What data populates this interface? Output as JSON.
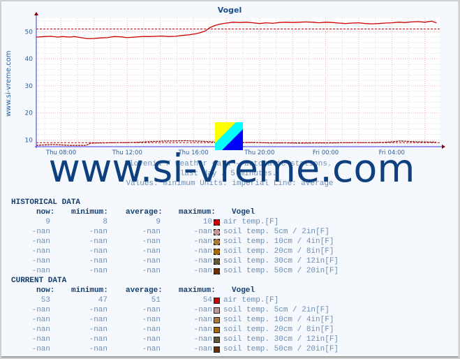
{
  "chart_data": {
    "type": "line",
    "title": "Vogel",
    "ylabel": "www.si-vreme.com",
    "xlabel": "",
    "ylim": [
      7.5,
      55
    ],
    "yticks": [
      10,
      20,
      30,
      40,
      50
    ],
    "xlim_hours": [
      6.5,
      30.9
    ],
    "xticks": [
      {
        "label": "Thu 08:00",
        "hour": 8
      },
      {
        "label": "Thu 12:00",
        "hour": 12
      },
      {
        "label": "Thu 16:00",
        "hour": 16
      },
      {
        "label": "Thu 20:00",
        "hour": 20
      },
      {
        "label": "Fri 00:00",
        "hour": 24
      },
      {
        "label": "Fri 04:00",
        "hour": 28
      }
    ],
    "grid": true,
    "series": [
      {
        "name": "air temp.[F] current",
        "color": "#cc0000",
        "style": "solid",
        "x_hours": [
          6.5,
          7.0,
          7.4,
          7.8,
          8.1,
          8.5,
          8.8,
          9.2,
          9.6,
          10.0,
          10.4,
          10.8,
          11.2,
          11.6,
          12.0,
          12.4,
          12.9,
          13.3,
          13.7,
          14.1,
          14.5,
          14.9,
          15.3,
          15.7,
          16.1,
          16.4,
          16.7,
          17.0,
          17.3,
          17.6,
          18.0,
          18.4,
          18.8,
          19.2,
          19.6,
          20.0,
          20.4,
          20.8,
          21.2,
          21.6,
          22.0,
          22.4,
          22.8,
          23.2,
          23.6,
          24.0,
          24.4,
          24.8,
          25.2,
          25.6,
          26.0,
          26.4,
          26.8,
          27.2,
          27.6,
          28.0,
          28.4,
          28.8,
          29.2,
          29.6,
          30.0,
          30.4,
          30.7
        ],
        "values": [
          48,
          48.2,
          48.3,
          48,
          48.2,
          48,
          48.2,
          47.8,
          47.4,
          47.5,
          47.7,
          47.8,
          48.2,
          48.1,
          47.8,
          48,
          48.2,
          48.2,
          48.3,
          48.4,
          48.2,
          48.3,
          48.6,
          48.8,
          49.2,
          49.6,
          50.2,
          51.5,
          52.3,
          52.8,
          53.2,
          53.5,
          53.4,
          53.5,
          53.3,
          53,
          53.3,
          53.1,
          53.4,
          53.5,
          53.4,
          53.5,
          53.6,
          53.5,
          53.3,
          53.5,
          53.4,
          53.2,
          53.0,
          53.2,
          53.3,
          53.0,
          52.9,
          53.0,
          53.2,
          53.3,
          53.5,
          53.4,
          53.6,
          53.7,
          53.5,
          53.9,
          53.3
        ]
      },
      {
        "name": "air temp.[F] current average",
        "color": "#cc0000",
        "style": "dashed",
        "constant": 51
      },
      {
        "name": "air temp.[F] historical",
        "color": "#880000",
        "style": "dashed",
        "x_hours": [
          6.5,
          7.5,
          8.5,
          9.5,
          9.8,
          10.5,
          11.5,
          12.5,
          13.5,
          14.5,
          15.5,
          16.5,
          17.5,
          18.5,
          19.5,
          20.5,
          21.5,
          22.5,
          23.5,
          24.5,
          25.5,
          26.5,
          27.5,
          28.0,
          28.5,
          29.5,
          30.5,
          30.7
        ],
        "values": [
          8.0,
          8.3,
          8.0,
          8.0,
          8.8,
          8.9,
          9.0,
          9.1,
          9.4,
          9.6,
          9.7,
          9.5,
          9.2,
          9.0,
          9.1,
          8.9,
          8.9,
          8.8,
          8.9,
          8.9,
          9.0,
          9.0,
          9.1,
          9.3,
          9.6,
          9.3,
          9.2,
          9.1
        ]
      },
      {
        "name": "air temp.[F] historical average",
        "color": "#cc0000",
        "style": "dashed",
        "constant": 9
      }
    ]
  },
  "chart": {
    "title": "Vogel",
    "side_label": "www.si-vreme.com",
    "subtitle_lines": [
      "Slovenia / weather data - automatic stations.",
      "last day / 5 minutes.",
      "Values: minimum  Units: imperial  Line: average"
    ],
    "watermark": "www.si-vreme.com",
    "logo_colors": [
      "#ffff00",
      "#00ffff",
      "#0000ff"
    ]
  },
  "historical": {
    "title": "HISTORICAL DATA",
    "headers": {
      "now": "now:",
      "minimum": "minimum:",
      "average": "average:",
      "maximum": "maximum:",
      "station": "Vogel"
    },
    "rows": [
      {
        "now": "9",
        "minimum": "8",
        "average": "9",
        "maximum": "10",
        "label": "air temp.[F]",
        "color": "#cc0000"
      },
      {
        "now": "-nan",
        "minimum": "-nan",
        "average": "-nan",
        "maximum": "-nan",
        "label": "soil temp. 5cm / 2in[F]",
        "color": "#c09898"
      },
      {
        "now": "-nan",
        "minimum": "-nan",
        "average": "-nan",
        "maximum": "-nan",
        "label": "soil temp. 10cm / 4in[F]",
        "color": "#b07838"
      },
      {
        "now": "-nan",
        "minimum": "-nan",
        "average": "-nan",
        "maximum": "-nan",
        "label": "soil temp. 20cm / 8in[F]",
        "color": "#a86800"
      },
      {
        "now": "-nan",
        "minimum": "-nan",
        "average": "-nan",
        "maximum": "-nan",
        "label": "soil temp. 30cm / 12in[F]",
        "color": "#605838"
      },
      {
        "now": "-nan",
        "minimum": "-nan",
        "average": "-nan",
        "maximum": "-nan",
        "label": "soil temp. 50cm / 20in[F]",
        "color": "#683008"
      }
    ]
  },
  "current": {
    "title": "CURRENT DATA",
    "headers": {
      "now": "now:",
      "minimum": "minimum:",
      "average": "average:",
      "maximum": "maximum:",
      "station": "Vogel"
    },
    "rows": [
      {
        "now": "53",
        "minimum": "47",
        "average": "51",
        "maximum": "54",
        "label": "air temp.[F]",
        "color": "#cc0000"
      },
      {
        "now": "-nan",
        "minimum": "-nan",
        "average": "-nan",
        "maximum": "-nan",
        "label": "soil temp. 5cm / 2in[F]",
        "color": "#c09898"
      },
      {
        "now": "-nan",
        "minimum": "-nan",
        "average": "-nan",
        "maximum": "-nan",
        "label": "soil temp. 10cm / 4in[F]",
        "color": "#b07838"
      },
      {
        "now": "-nan",
        "minimum": "-nan",
        "average": "-nan",
        "maximum": "-nan",
        "label": "soil temp. 20cm / 8in[F]",
        "color": "#a86800"
      },
      {
        "now": "-nan",
        "minimum": "-nan",
        "average": "-nan",
        "maximum": "-nan",
        "label": "soil temp. 30cm / 12in[F]",
        "color": "#605838"
      },
      {
        "now": "-nan",
        "minimum": "-nan",
        "average": "-nan",
        "maximum": "-nan",
        "label": "soil temp. 50cm / 20in[F]",
        "color": "#683008"
      }
    ]
  }
}
